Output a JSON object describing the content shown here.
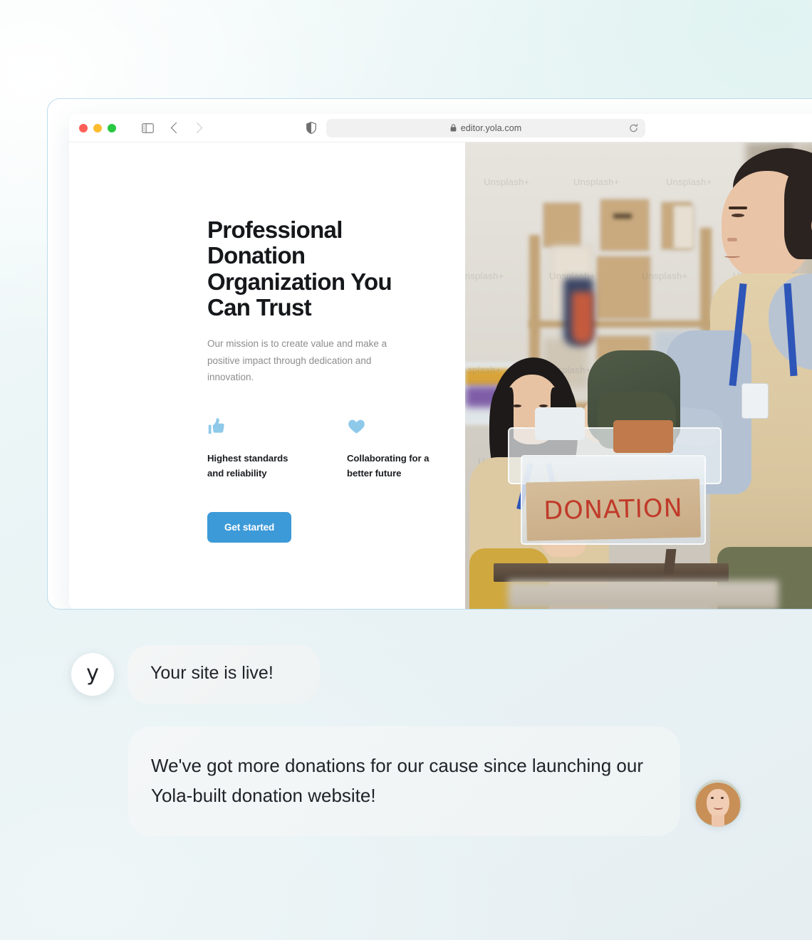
{
  "background": {
    "accent_mint": "#e0f3f1",
    "base": "#e9f3f5"
  },
  "browser": {
    "traffic_lights": [
      "close",
      "minimize",
      "zoom"
    ],
    "sidebar_toggle_icon": "sidebar-icon",
    "back_icon": "chevron-left-icon",
    "forward_icon": "chevron-right-icon",
    "privacy_icon": "shield-icon",
    "url": "editor.yola.com",
    "url_lock_icon": "lock-icon",
    "reload_icon": "reload-icon"
  },
  "site": {
    "hero": {
      "title": "Professional Donation Organization You Can Trust",
      "subtitle": "Our mission is to create value and make a positive impact through dedication and innovation.",
      "cta_label": "Get started",
      "cta_color": "#3d9ad8",
      "features": [
        {
          "icon": "thumbs-up-icon",
          "label": "Highest standards and reliability",
          "color": "#8ec9ea"
        },
        {
          "icon": "heart-icon",
          "label": "Collaborating for a better future",
          "color": "#8ec9ea"
        }
      ]
    },
    "photo": {
      "alt": "Two volunteers sorting clothing donations in a warehouse",
      "sign_text": "DONATION",
      "sign_color": "#c03a2a",
      "watermark": "Unsplash+"
    }
  },
  "chat": {
    "messages": [
      {
        "avatar_letter": "y",
        "avatar_name": "yola-logo",
        "text": "Your site is live!"
      },
      {
        "text": "We've got more donations for our cause since launching our Yola-built donation website!",
        "avatar_name": "customer-photo"
      }
    ]
  }
}
